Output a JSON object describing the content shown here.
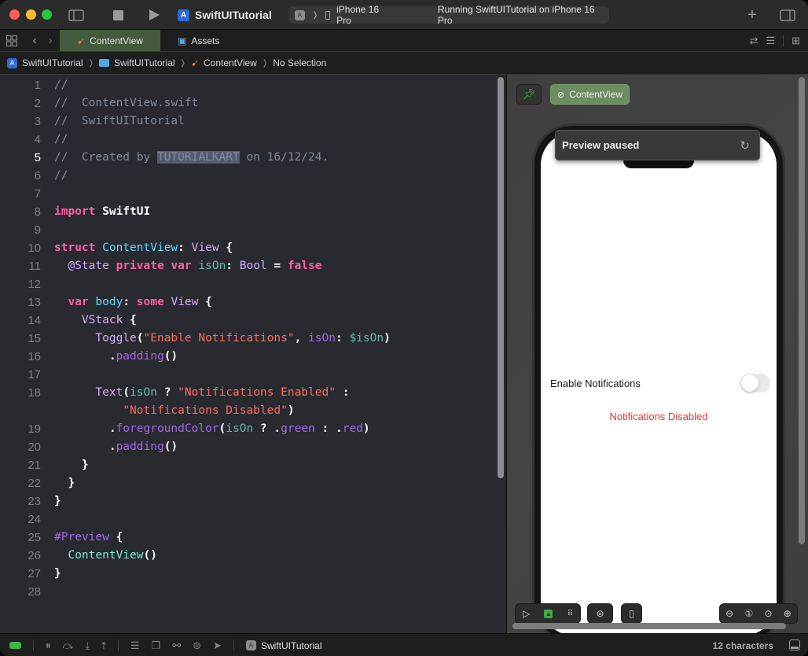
{
  "titlebar": {
    "app_title": "SwiftUITutorial",
    "device": "iPhone 16 Pro",
    "status": "Running SwiftUITutorial on iPhone 16 Pro",
    "icons": [
      "sidebar-toggle-icon",
      "stop-icon",
      "run-icon",
      "add-icon",
      "inspector-toggle-icon"
    ]
  },
  "tabs": [
    {
      "label": "ContentView",
      "icon": "swift-icon",
      "active": true
    },
    {
      "label": "Assets",
      "icon": "assets-icon",
      "active": false
    }
  ],
  "breadcrumb": [
    {
      "label": "SwiftUITutorial",
      "icon": "app-icon"
    },
    {
      "label": "SwiftUITutorial",
      "icon": "folder-icon"
    },
    {
      "label": "ContentView",
      "icon": "swift-icon"
    },
    {
      "label": "No Selection",
      "icon": ""
    }
  ],
  "editor": {
    "current_line": 5,
    "lines": [
      {
        "n": "1",
        "text": "//"
      },
      {
        "n": "2",
        "text": "//  ContentView.swift"
      },
      {
        "n": "3",
        "text": "//  SwiftUITutorial"
      },
      {
        "n": "4",
        "text": "//"
      },
      {
        "n": "5",
        "text": "//  Created by TUTORIALKART on 16/12/24.",
        "selected": "TUTORIALKART"
      },
      {
        "n": "6",
        "text": "//"
      },
      {
        "n": "7",
        "text": ""
      },
      {
        "n": "8",
        "text": "import SwiftUI"
      },
      {
        "n": "9",
        "text": ""
      },
      {
        "n": "10",
        "text": "struct ContentView: View {"
      },
      {
        "n": "11",
        "text": "  @State private var isOn: Bool = false"
      },
      {
        "n": "12",
        "text": ""
      },
      {
        "n": "13",
        "text": "  var body: some View {"
      },
      {
        "n": "14",
        "text": "    VStack {"
      },
      {
        "n": "15",
        "text": "      Toggle(\"Enable Notifications\", isOn: $isOn)"
      },
      {
        "n": "16",
        "text": "        .padding()"
      },
      {
        "n": "17",
        "text": ""
      },
      {
        "n": "18",
        "text": "      Text(isOn ? \"Notifications Enabled\" :"
      },
      {
        "n": "",
        "text": "          \"Notifications Disabled\")"
      },
      {
        "n": "19",
        "text": "        .foregroundColor(isOn ? .green : .red)"
      },
      {
        "n": "20",
        "text": "        .padding()"
      },
      {
        "n": "21",
        "text": "    }"
      },
      {
        "n": "22",
        "text": "  }"
      },
      {
        "n": "23",
        "text": "}"
      },
      {
        "n": "24",
        "text": ""
      },
      {
        "n": "25",
        "text": "#Preview {"
      },
      {
        "n": "26",
        "text": "  ContentView()"
      },
      {
        "n": "27",
        "text": "}"
      },
      {
        "n": "28",
        "text": ""
      }
    ]
  },
  "preview": {
    "pin_icon": "pin-icon",
    "view_button": "ContentView",
    "paused_label": "Preview paused",
    "toggle_label": "Enable Notifications",
    "toggle_on": false,
    "status_text": "Notifications Disabled",
    "status_color": "#e8322e",
    "toolbar_icons": [
      "live-icon",
      "select-icon",
      "variants-icon",
      "settings-icon",
      "device-icon",
      "zoom-out-icon",
      "zoom-100-icon",
      "zoom-fit-icon",
      "zoom-in-icon"
    ]
  },
  "statusbar": {
    "scheme": "SwiftUITutorial",
    "chars": "12 characters"
  },
  "colors": {
    "keyword": "#fc5fa3",
    "string": "#fc6a5d",
    "comment": "#7f8c98",
    "accent_green": "#3fb54a"
  }
}
